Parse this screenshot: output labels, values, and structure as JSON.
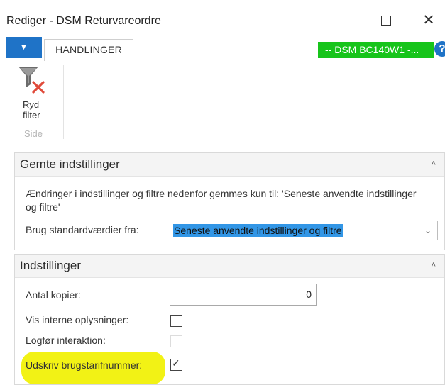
{
  "window": {
    "title": "Rediger - DSM Returvareordre",
    "minimize_icon": "minimize-icon",
    "maximize_icon": "maximize-icon",
    "close_symbol": "✕"
  },
  "tabbar": {
    "menu_symbol": "▼",
    "actions_tab": "HANDLINGER",
    "company": "-- DSM BC140W1 -...",
    "help_symbol": "?"
  },
  "ribbon": {
    "clear_filter_label": "Ryd filter",
    "group_label": "Side",
    "icon": "clear-filter-icon"
  },
  "saved_settings": {
    "title": "Gemte indstillinger",
    "chevron": "˄",
    "info": "Ændringer i indstillinger og filtre nedenfor gemmes kun til: 'Seneste anvendte indstillinger og filtre'",
    "defaults_label": "Brug standardværdier fra:",
    "defaults_value": "Seneste anvendte indstillinger og filtre",
    "dropdown_arrow": "⌄"
  },
  "settings": {
    "title": "Indstillinger",
    "chevron": "˄",
    "copies_label": "Antal kopier:",
    "copies_value": "0",
    "internal_info_label": "Vis interne oplysninger:",
    "internal_info_checked": false,
    "log_interaction_label": "Logfør interaktion:",
    "log_interaction_checked": false,
    "log_interaction_enabled": false,
    "print_tariff_label": "Udskriv brugstarifnummer:",
    "print_tariff_checked": true,
    "checkmark_symbol": "✓",
    "highlight_color": "#f2f215"
  },
  "colors": {
    "accent_blue": "#1f73c7",
    "company_green": "#17c41b",
    "selection_blue": "#3296e6"
  }
}
